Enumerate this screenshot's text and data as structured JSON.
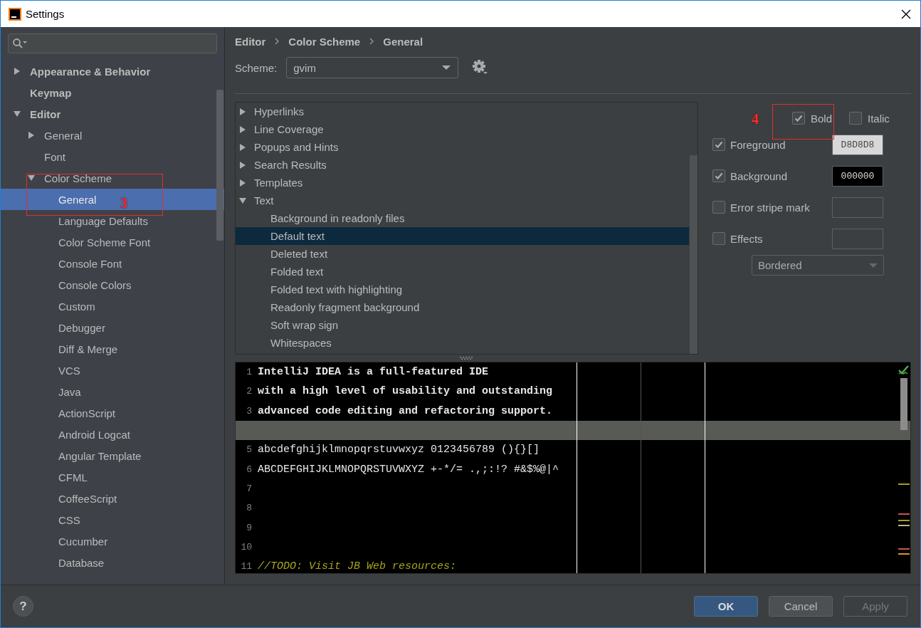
{
  "window": {
    "title": "Settings"
  },
  "sidebar": {
    "tree": [
      {
        "label": "Appearance & Behavior",
        "expanded": false,
        "selected": false
      },
      {
        "label": "Keymap",
        "selected": false
      },
      {
        "label": "Editor",
        "expanded": true,
        "selected": false,
        "children": [
          {
            "label": "General",
            "expanded": false,
            "selected": false
          },
          {
            "label": "Font",
            "selected": false
          },
          {
            "label": "Color Scheme",
            "expanded": true,
            "selected": false,
            "children": [
              {
                "label": "General",
                "selected": true
              },
              {
                "label": "Language Defaults",
                "selected": false
              },
              {
                "label": "Color Scheme Font",
                "selected": false
              },
              {
                "label": "Console Font",
                "selected": false
              },
              {
                "label": "Console Colors",
                "selected": false
              },
              {
                "label": "Custom",
                "selected": false
              },
              {
                "label": "Debugger",
                "selected": false
              },
              {
                "label": "Diff & Merge",
                "selected": false
              },
              {
                "label": "VCS",
                "selected": false
              },
              {
                "label": "Java",
                "selected": false
              },
              {
                "label": "ActionScript",
                "selected": false
              },
              {
                "label": "Android Logcat",
                "selected": false
              },
              {
                "label": "Angular Template",
                "selected": false
              },
              {
                "label": "CFML",
                "selected": false
              },
              {
                "label": "CoffeeScript",
                "selected": false
              },
              {
                "label": "CSS",
                "selected": false
              },
              {
                "label": "Cucumber",
                "selected": false
              },
              {
                "label": "Database",
                "selected": false
              }
            ]
          }
        ]
      }
    ]
  },
  "breadcrumb": [
    "Editor",
    "Color Scheme",
    "General"
  ],
  "scheme": {
    "label": "Scheme:",
    "value": "gvim"
  },
  "attributes": [
    {
      "label": "Hyperlinks",
      "expanded": false,
      "selected": false
    },
    {
      "label": "Line Coverage",
      "expanded": false,
      "selected": false
    },
    {
      "label": "Popups and Hints",
      "expanded": false,
      "selected": false
    },
    {
      "label": "Search Results",
      "expanded": false,
      "selected": false
    },
    {
      "label": "Templates",
      "expanded": false,
      "selected": false
    },
    {
      "label": "Text",
      "expanded": true,
      "selected": false,
      "children": [
        {
          "label": "Background in readonly files",
          "selected": false
        },
        {
          "label": "Default text",
          "selected": true
        },
        {
          "label": "Deleted text",
          "selected": false
        },
        {
          "label": "Folded text",
          "selected": false
        },
        {
          "label": "Folded text with highlighting",
          "selected": false
        },
        {
          "label": "Readonly fragment background",
          "selected": false
        },
        {
          "label": "Soft wrap sign",
          "selected": false
        },
        {
          "label": "Whitespaces",
          "selected": false
        }
      ]
    }
  ],
  "font_style": [
    {
      "label": "Bold",
      "checked": true
    },
    {
      "label": "Italic",
      "checked": false
    }
  ],
  "properties": [
    {
      "label": "Foreground",
      "checked": true,
      "value": "D8D8D8"
    },
    {
      "label": "Background",
      "checked": true,
      "value": "000000"
    },
    {
      "label": "Error stripe mark",
      "checked": false
    },
    {
      "label": "Effects",
      "checked": false
    }
  ],
  "effect_type": {
    "value": "Bordered"
  },
  "preview": {
    "lines": [
      {
        "number": "1",
        "kind": "bold",
        "text": "IntelliJ IDEA is a full-featured IDE",
        "current": false
      },
      {
        "number": "2",
        "kind": "bold",
        "text": "with a high level of usability and outstanding",
        "current": false
      },
      {
        "number": "3",
        "kind": "bold",
        "text": "advanced code editing and refactoring support.",
        "current": false
      },
      {
        "current": true
      },
      {
        "number": "5",
        "kind": "plain",
        "text": "abcdefghijklmnopqrstuvwxyz 0123456789 (){}[]",
        "current": false
      },
      {
        "number": "6",
        "kind": "plain",
        "text": "ABCDEFGHIJKLMNOPQRSTUVWXYZ +-*/= .,;:!? #&$%@|^",
        "current": false
      },
      {
        "number": "7",
        "current": false
      },
      {
        "number": "8",
        "current": false
      },
      {
        "number": "9",
        "current": false
      },
      {
        "number": "10",
        "current": false
      },
      {
        "number": "11",
        "kind": "comment",
        "text": "//TODO: Visit JB Web resources:",
        "current": false
      }
    ]
  },
  "footer": {
    "help": "?",
    "buttons": [
      {
        "label": "OK",
        "primary": true,
        "disabled": false
      },
      {
        "label": "Cancel",
        "primary": false,
        "disabled": false
      },
      {
        "label": "Apply",
        "primary": false,
        "disabled": true
      }
    ]
  },
  "annotations": [
    {
      "label": "3"
    },
    {
      "label": "4"
    }
  ]
}
